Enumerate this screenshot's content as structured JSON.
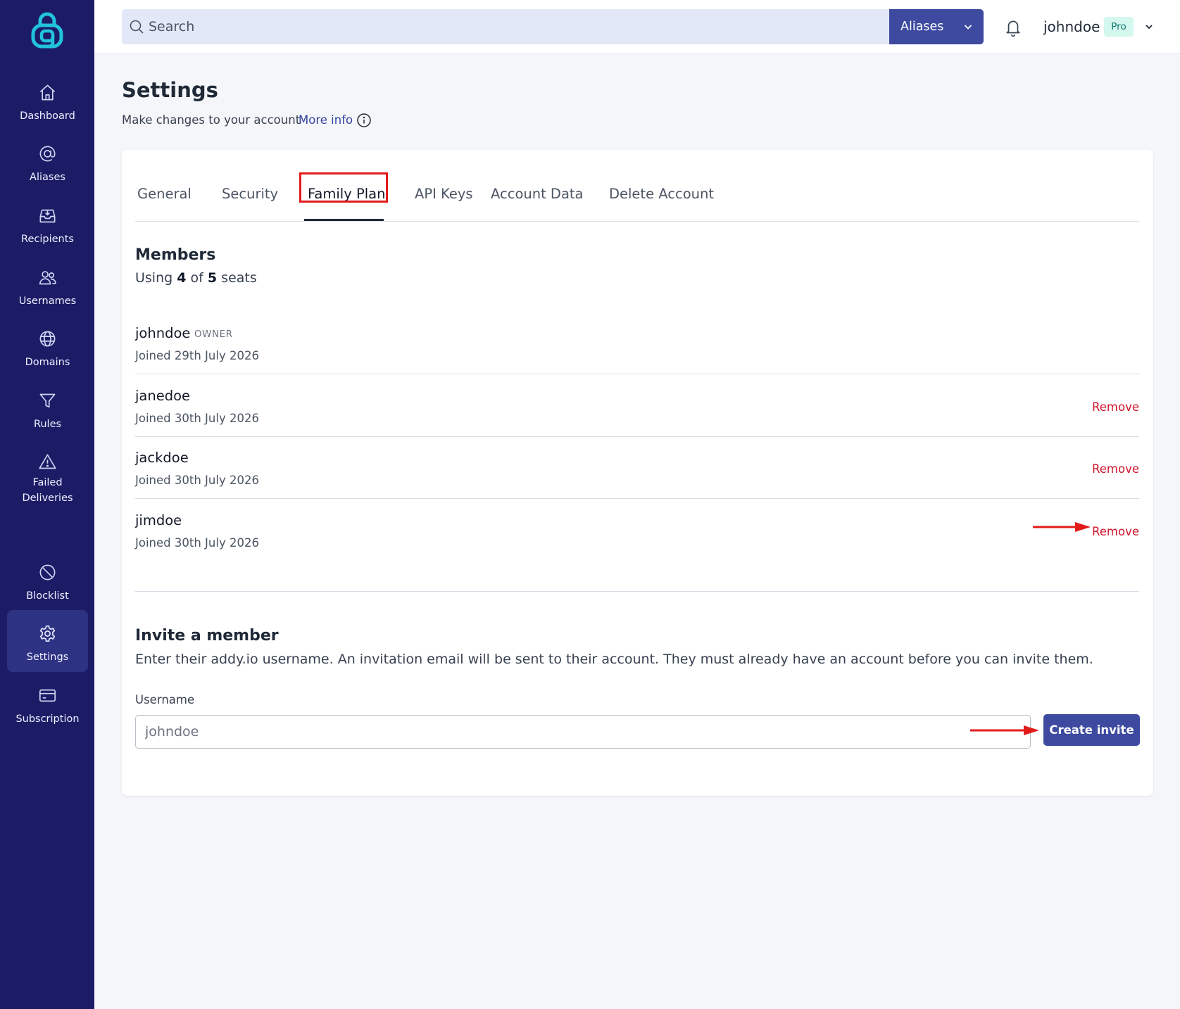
{
  "sidebar": {
    "items": [
      {
        "label": "Dashboard",
        "icon": "home-icon"
      },
      {
        "label": "Aliases",
        "icon": "at-sign-icon"
      },
      {
        "label": "Recipients",
        "icon": "inbox-icon"
      },
      {
        "label": "Usernames",
        "icon": "users-icon"
      },
      {
        "label": "Domains",
        "icon": "globe-icon"
      },
      {
        "label": "Rules",
        "icon": "funnel-icon"
      },
      {
        "label": "Failed Deliveries",
        "icon": "warning-icon"
      },
      {
        "label": "Blocklist",
        "icon": "ban-icon"
      },
      {
        "label": "Settings",
        "icon": "gear-icon"
      },
      {
        "label": "Subscription",
        "icon": "credit-card-icon"
      }
    ],
    "active": "Settings"
  },
  "header": {
    "search_placeholder": "Search",
    "search_scope": "Aliases",
    "username": "johndoe",
    "plan_badge": "Pro"
  },
  "page": {
    "title": "Settings",
    "subtitle": "Make changes to your account",
    "more_info": "More info"
  },
  "tabs": [
    {
      "label": "General",
      "active": false
    },
    {
      "label": "Security",
      "active": false
    },
    {
      "label": "Family Plan",
      "active": true
    },
    {
      "label": "API Keys",
      "active": false
    },
    {
      "label": "Account Data",
      "active": false
    },
    {
      "label": "Delete Account",
      "active": false
    }
  ],
  "members": {
    "title": "Members",
    "seats_prefix": "Using",
    "seats_used": "4",
    "seats_of": "of",
    "seats_total": "5",
    "seats_suffix": "seats",
    "list": [
      {
        "name": "johndoe",
        "role": "OWNER",
        "joined": "Joined 29th July 2026",
        "action": ""
      },
      {
        "name": "janedoe",
        "role": "",
        "joined": "Joined 30th July 2026",
        "action": "Remove"
      },
      {
        "name": "jackdoe",
        "role": "",
        "joined": "Joined 30th July 2026",
        "action": "Remove"
      },
      {
        "name": "jimdoe",
        "role": "",
        "joined": "Joined 30th July 2026",
        "action": "Remove"
      }
    ]
  },
  "invite": {
    "title": "Invite a member",
    "description": "Enter their addy.io username. An invitation email will be sent to their account. They must already have an account before you can invite them.",
    "field_label": "Username",
    "field_placeholder": "johndoe",
    "field_value": "",
    "button_label": "Create invite"
  },
  "colors": {
    "sidebar_bg": "#1c1c66",
    "accent": "#3d4aa0",
    "danger": "#d0162c",
    "annotation": "#e21b1b",
    "logo": "#22c3dc"
  }
}
